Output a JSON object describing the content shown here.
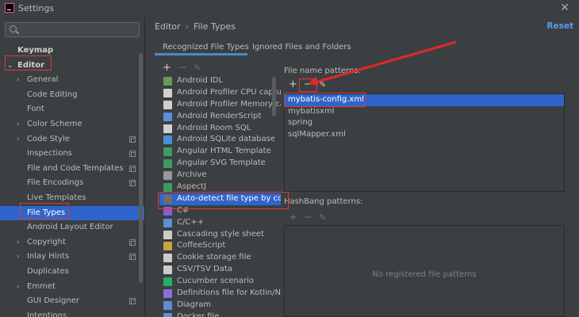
{
  "window": {
    "title": "Settings"
  },
  "search": {
    "placeholder": ""
  },
  "sidebar": {
    "items": [
      {
        "label": "Keymap",
        "bold": true,
        "indent": 22,
        "chevron": ""
      },
      {
        "label": "Editor",
        "bold": true,
        "indent": 22,
        "chevron": "down"
      },
      {
        "label": "General",
        "indent": 34,
        "chevron": "right"
      },
      {
        "label": "Code Editing",
        "indent": 34,
        "chevron": ""
      },
      {
        "label": "Font",
        "indent": 34,
        "chevron": ""
      },
      {
        "label": "Color Scheme",
        "indent": 34,
        "chevron": "right"
      },
      {
        "label": "Code Style",
        "indent": 34,
        "chevron": "right",
        "copy": true
      },
      {
        "label": "Inspections",
        "indent": 34,
        "chevron": "",
        "copy": true
      },
      {
        "label": "File and Code Templates",
        "indent": 34,
        "chevron": "",
        "copy": true
      },
      {
        "label": "File Encodings",
        "indent": 34,
        "chevron": "",
        "copy": true
      },
      {
        "label": "Live Templates",
        "indent": 34,
        "chevron": ""
      },
      {
        "label": "File Types",
        "indent": 34,
        "chevron": "",
        "selected": true
      },
      {
        "label": "Android Layout Editor",
        "indent": 34,
        "chevron": ""
      },
      {
        "label": "Copyright",
        "indent": 34,
        "chevron": "right",
        "copy": true
      },
      {
        "label": "Inlay Hints",
        "indent": 34,
        "chevron": "right",
        "copy": true
      },
      {
        "label": "Duplicates",
        "indent": 34,
        "chevron": ""
      },
      {
        "label": "Emmet",
        "indent": 34,
        "chevron": "right"
      },
      {
        "label": "GUI Designer",
        "indent": 34,
        "chevron": "",
        "copy": true
      },
      {
        "label": "Intentions",
        "indent": 34,
        "chevron": ""
      }
    ]
  },
  "breadcrumb": {
    "parent": "Editor",
    "separator": "›",
    "current": "File Types"
  },
  "reset_label": "Reset",
  "tabs": [
    {
      "label": "Recognized File Types",
      "active": true
    },
    {
      "label": "Ignored Files and Folders",
      "active": false
    }
  ],
  "file_types": [
    {
      "label": "Android IDL",
      "color": "#6a9955"
    },
    {
      "label": "Android Profiler CPU capture",
      "color": "#d0d0d0"
    },
    {
      "label": "Android Profiler Memory capt",
      "color": "#d0d0d0"
    },
    {
      "label": "Android RenderScript",
      "color": "#5b8fd6"
    },
    {
      "label": "Android Room SQL",
      "color": "#d0d0d0"
    },
    {
      "label": "Android SQLite database",
      "color": "#4a90d9"
    },
    {
      "label": "Angular HTML Template",
      "color": "#3f9a5e"
    },
    {
      "label": "Angular SVG Template",
      "color": "#3f9a5e"
    },
    {
      "label": "Archive",
      "color": "#999999"
    },
    {
      "label": "AspectJ",
      "color": "#3f9a5e"
    },
    {
      "label": "Auto-detect file type by conte",
      "color": "#6e6e6e",
      "selected": true
    },
    {
      "label": "C#",
      "color": "#8a5bd6"
    },
    {
      "label": "C/C++",
      "color": "#5b8fd6"
    },
    {
      "label": "Cascading style sheet",
      "color": "#cccccc"
    },
    {
      "label": "CoffeeScript",
      "color": "#c9a347"
    },
    {
      "label": "Cookie storage file",
      "color": "#cccccc"
    },
    {
      "label": "CSV/TSV Data",
      "color": "#cccccc"
    },
    {
      "label": "Cucumber scenario",
      "color": "#27ae60"
    },
    {
      "label": "Definitions file for Kotlin/Nativ",
      "color": "#8a6ee0"
    },
    {
      "label": "Diagram",
      "color": "#5b8fd6"
    },
    {
      "label": "Docker file",
      "color": "#5b8fd6"
    }
  ],
  "patterns": {
    "label": "File name patterns:",
    "items": [
      "mybatis-config.xml",
      "mybatisxml",
      "spring",
      "sqlMapper.xml"
    ],
    "selected_index": 0
  },
  "hashbang": {
    "label": "HashBang patterns:",
    "empty_message": "No registered file patterns"
  },
  "toolbar": {
    "add": "+",
    "remove": "−",
    "edit": "✎"
  },
  "colors": {
    "accent": "#2f65ca",
    "link": "#589df6",
    "annotation": "#e03a3a",
    "background": "#3c3f41"
  }
}
